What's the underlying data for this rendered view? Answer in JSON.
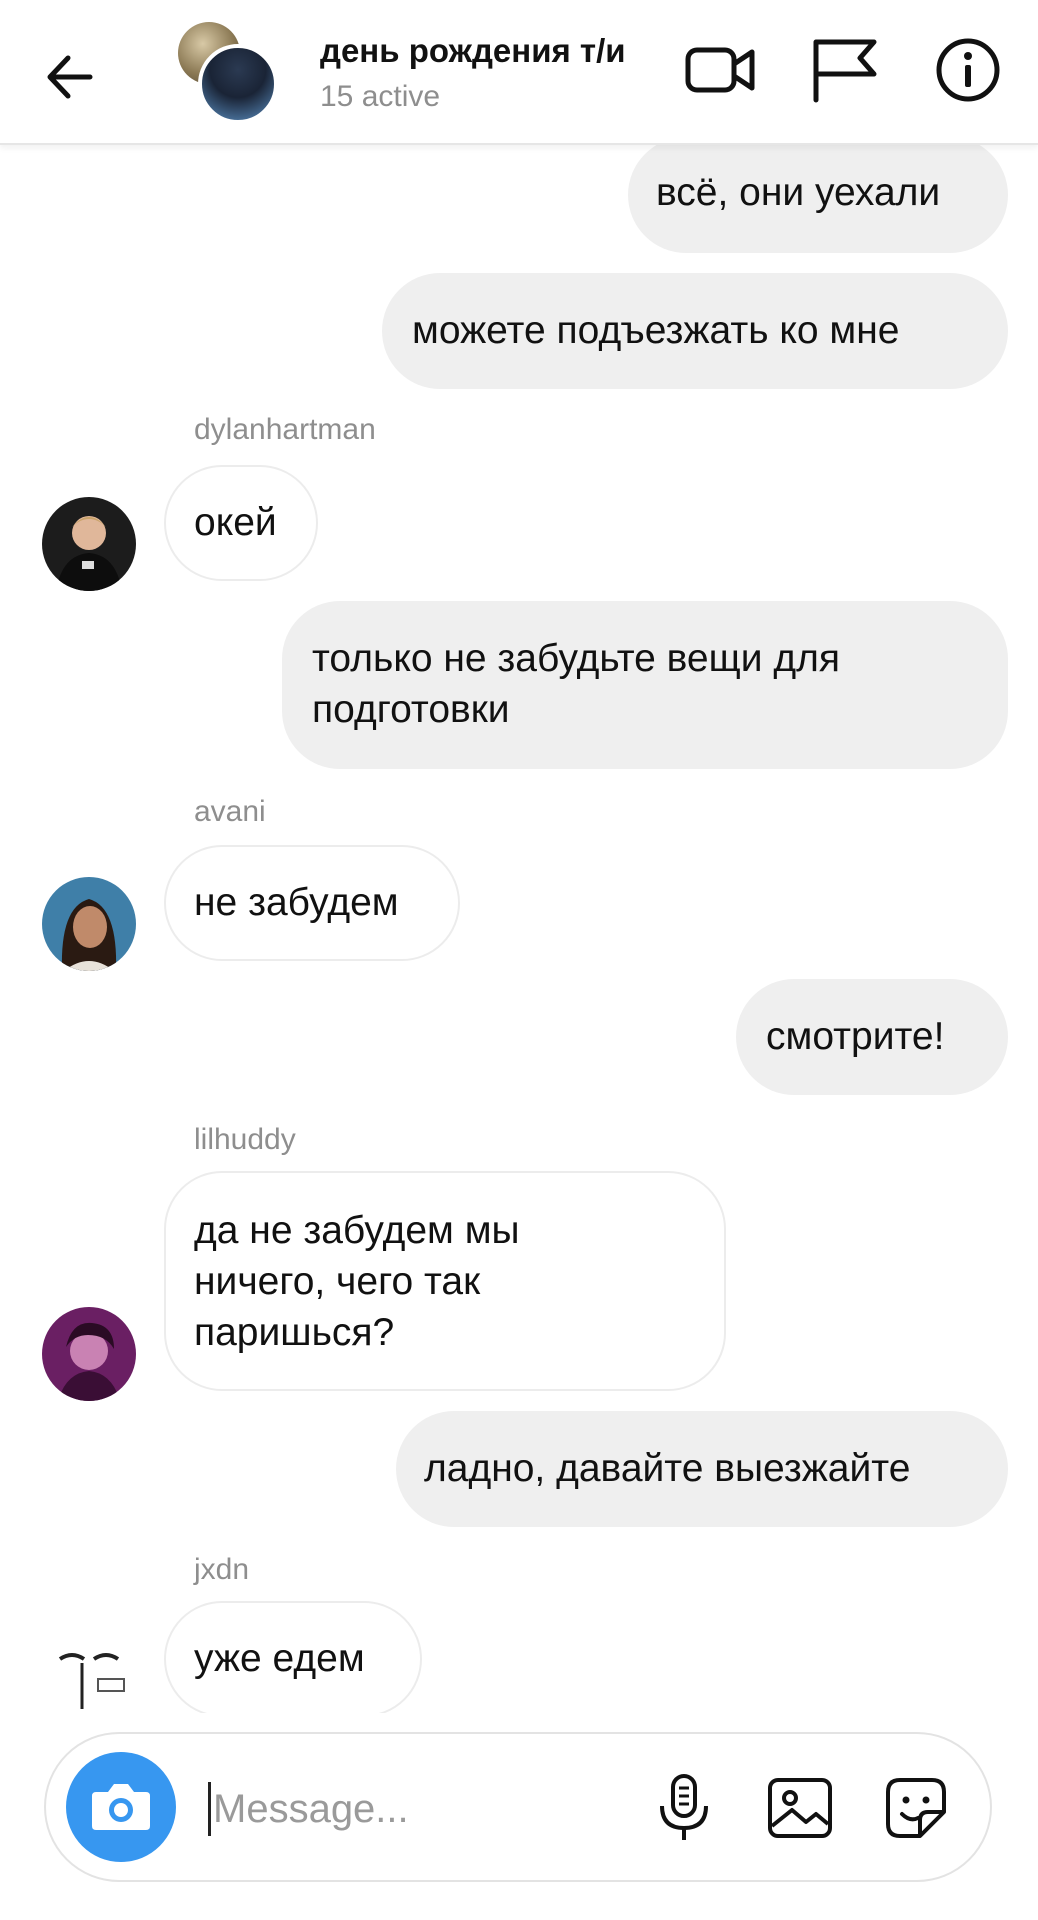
{
  "header": {
    "title": "день рождения т/и",
    "status": "15 active",
    "back_icon": "arrow-left-icon",
    "video_icon": "video-call-icon",
    "flag_icon": "flag-icon",
    "info_icon": "info-icon"
  },
  "messages": [
    {
      "direction": "outgoing",
      "lines": [
        "всё, они уехали"
      ]
    },
    {
      "direction": "outgoing",
      "lines": [
        "можете подъезжать ко мне"
      ]
    },
    {
      "direction": "incoming",
      "sender": "dylanhartman",
      "lines": [
        "окей"
      ]
    },
    {
      "direction": "outgoing",
      "lines": [
        "только не забудьте вещи для",
        "подготовки"
      ]
    },
    {
      "direction": "incoming",
      "sender": "avani",
      "lines": [
        "не забудем"
      ]
    },
    {
      "direction": "outgoing",
      "lines": [
        "смотрите!"
      ]
    },
    {
      "direction": "incoming",
      "sender": "lilhuddy",
      "lines": [
        "да не забудем мы",
        "ничего, чего так",
        "паришься?"
      ]
    },
    {
      "direction": "outgoing",
      "lines": [
        "ладно, давайте выезжайте"
      ]
    },
    {
      "direction": "incoming",
      "sender": "jxdn",
      "lines": [
        "уже едем"
      ]
    }
  ],
  "composer": {
    "placeholder": "Message...",
    "camera_icon": "camera-icon",
    "mic_icon": "microphone-icon",
    "gallery_icon": "gallery-icon",
    "sticker_icon": "sticker-icon"
  },
  "colors": {
    "accent": "#3797f0",
    "outgoing_bubble": "#efefef",
    "incoming_border": "#ececec",
    "muted_text": "#8e8e8e"
  }
}
